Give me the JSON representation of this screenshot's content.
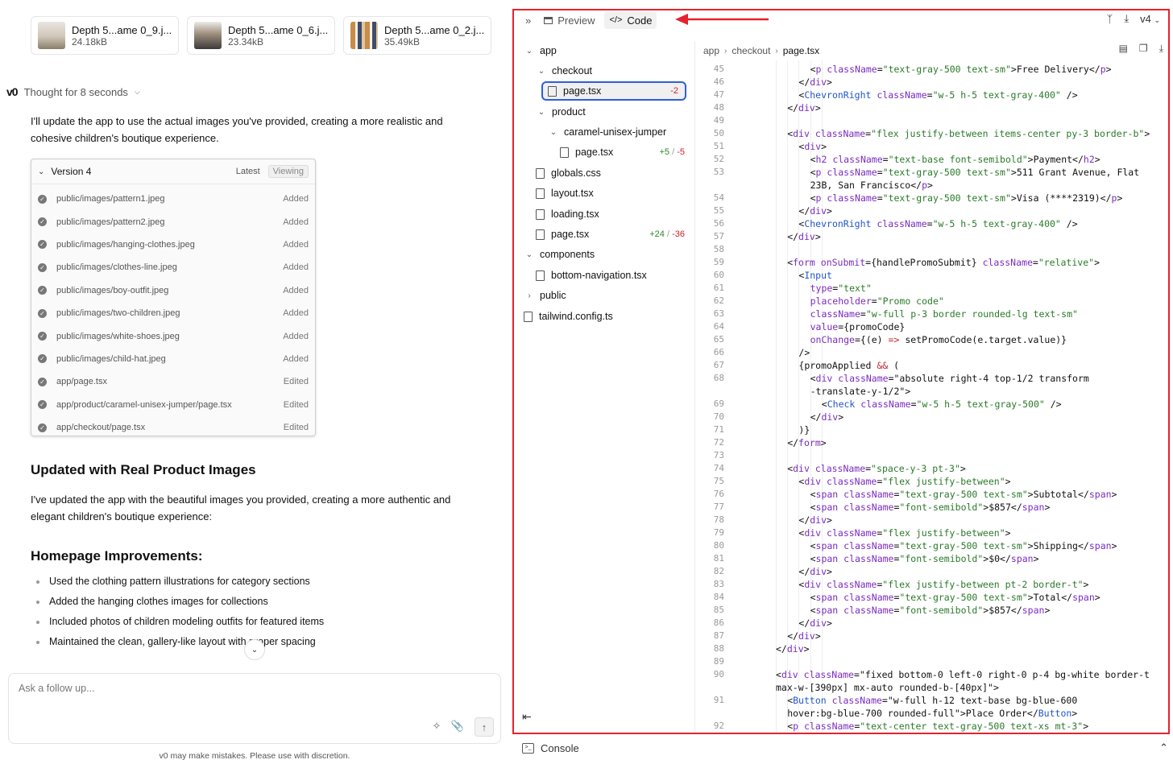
{
  "colors": {
    "accent_red": "#e5222f",
    "selection_blue": "#2f5fd8",
    "add_green": "#2a8a2a",
    "del_red": "#c8262d"
  },
  "attachments": [
    {
      "name": "Depth 5...ame 0_9.j...",
      "size": "24.18kB"
    },
    {
      "name": "Depth 5...ame 0_6.j...",
      "size": "23.34kB"
    },
    {
      "name": "Depth 5...ame 0_2.j...",
      "size": "35.49kB"
    }
  ],
  "chat": {
    "logo": "v0",
    "thought": "Thought for 8 seconds",
    "intro": "I'll update the app to use the actual images you've provided, creating a more realistic and cohesive children's boutique experience.",
    "version": {
      "title": "Version 4",
      "latest": "Latest",
      "viewing": "Viewing",
      "files": [
        {
          "path": "public/images/pattern1.jpeg",
          "status": "Added"
        },
        {
          "path": "public/images/pattern2.jpeg",
          "status": "Added"
        },
        {
          "path": "public/images/hanging-clothes.jpeg",
          "status": "Added"
        },
        {
          "path": "public/images/clothes-line.jpeg",
          "status": "Added"
        },
        {
          "path": "public/images/boy-outfit.jpeg",
          "status": "Added"
        },
        {
          "path": "public/images/two-children.jpeg",
          "status": "Added"
        },
        {
          "path": "public/images/white-shoes.jpeg",
          "status": "Added"
        },
        {
          "path": "public/images/child-hat.jpeg",
          "status": "Added"
        },
        {
          "path": "app/page.tsx",
          "status": "Edited"
        },
        {
          "path": "app/product/caramel-unisex-jumper/page.tsx",
          "status": "Edited"
        },
        {
          "path": "app/checkout/page.tsx",
          "status": "Edited"
        }
      ]
    },
    "heading1": "Updated with Real Product Images",
    "para2": "I've updated the app with the beautiful images you provided, creating a more authentic and elegant children's boutique experience:",
    "heading2": "Homepage Improvements:",
    "bullets": [
      "Used the clothing pattern illustrations for category sections",
      "Added the hanging clothes images for collections",
      "Included photos of children modeling outfits for featured items",
      "Maintained the clean, gallery-like layout with proper spacing"
    ],
    "input_placeholder": "Ask a follow up...",
    "disclaimer": "v0 may make mistakes. Please use with discretion."
  },
  "code_pane": {
    "tabs": {
      "preview": "Preview",
      "code": "Code"
    },
    "version_select": "v4",
    "tree": [
      {
        "label": "app",
        "type": "folder",
        "level": 0,
        "open": true
      },
      {
        "label": "checkout",
        "type": "folder",
        "level": 1,
        "open": true
      },
      {
        "label": "page.tsx",
        "type": "file",
        "level": 2,
        "diff_del": "-2",
        "selected": true
      },
      {
        "label": "product",
        "type": "folder",
        "level": 1,
        "open": true
      },
      {
        "label": "caramel-unisex-jumper",
        "type": "folder",
        "level": 2,
        "open": true
      },
      {
        "label": "page.tsx",
        "type": "file",
        "level": 3,
        "diff_add": "+5",
        "diff_del": "-5"
      },
      {
        "label": "globals.css",
        "type": "file",
        "level": 1
      },
      {
        "label": "layout.tsx",
        "type": "file",
        "level": 1
      },
      {
        "label": "loading.tsx",
        "type": "file",
        "level": 1
      },
      {
        "label": "page.tsx",
        "type": "file",
        "level": 1,
        "diff_add": "+24",
        "diff_del": "-36"
      },
      {
        "label": "components",
        "type": "folder",
        "level": 0,
        "open": true
      },
      {
        "label": "bottom-navigation.tsx",
        "type": "file",
        "level": 1
      },
      {
        "label": "public",
        "type": "folder",
        "level": 0,
        "open": false
      },
      {
        "label": "tailwind.config.ts",
        "type": "file",
        "level": 0
      }
    ],
    "breadcrumb": [
      "app",
      "checkout",
      "page.tsx"
    ],
    "code_lines": [
      {
        "n": "45",
        "i": 3,
        "t": "<p className=\"text-gray-500 text-sm\">Free Delivery</p>"
      },
      {
        "n": "46",
        "i": 2,
        "t": "</div>"
      },
      {
        "n": "47",
        "i": 2,
        "t": "<ChevronRight className=\"w-5 h-5 text-gray-400\" />"
      },
      {
        "n": "48",
        "i": 1,
        "t": "</div>"
      },
      {
        "n": "49",
        "i": 0,
        "t": ""
      },
      {
        "n": "50",
        "i": 1,
        "t": "<div className=\"flex justify-between items-center py-3 border-b\">"
      },
      {
        "n": "51",
        "i": 2,
        "t": "<div>"
      },
      {
        "n": "52",
        "i": 3,
        "t": "<h2 className=\"text-base font-semibold\">Payment</h2>"
      },
      {
        "n": "53",
        "i": 3,
        "t": "<p className=\"text-gray-500 text-sm\">511 Grant Avenue, Flat"
      },
      {
        "n": "",
        "i": 3,
        "t": "23B, San Francisco</p>"
      },
      {
        "n": "54",
        "i": 3,
        "t": "<p className=\"text-gray-500 text-sm\">Visa (****2319)</p>"
      },
      {
        "n": "55",
        "i": 2,
        "t": "</div>"
      },
      {
        "n": "56",
        "i": 2,
        "t": "<ChevronRight className=\"w-5 h-5 text-gray-400\" />"
      },
      {
        "n": "57",
        "i": 1,
        "t": "</div>"
      },
      {
        "n": "58",
        "i": 0,
        "t": ""
      },
      {
        "n": "59",
        "i": 1,
        "t": "<form onSubmit={handlePromoSubmit} className=\"relative\">"
      },
      {
        "n": "60",
        "i": 2,
        "t": "<Input"
      },
      {
        "n": "61",
        "i": 3,
        "t": "type=\"text\""
      },
      {
        "n": "62",
        "i": 3,
        "t": "placeholder=\"Promo code\""
      },
      {
        "n": "63",
        "i": 3,
        "t": "className=\"w-full p-3 border rounded-lg text-sm\""
      },
      {
        "n": "64",
        "i": 3,
        "t": "value={promoCode}"
      },
      {
        "n": "65",
        "i": 3,
        "t": "onChange={(e) => setPromoCode(e.target.value)}"
      },
      {
        "n": "66",
        "i": 2,
        "t": "/>"
      },
      {
        "n": "67",
        "i": 2,
        "t": "{promoApplied && ("
      },
      {
        "n": "68",
        "i": 3,
        "t": "<div className=\"absolute right-4 top-1/2 transform"
      },
      {
        "n": "",
        "i": 3,
        "t": "-translate-y-1/2\">"
      },
      {
        "n": "69",
        "i": 4,
        "t": "<Check className=\"w-5 h-5 text-gray-500\" />"
      },
      {
        "n": "70",
        "i": 3,
        "t": "</div>"
      },
      {
        "n": "71",
        "i": 2,
        "t": ")}"
      },
      {
        "n": "72",
        "i": 1,
        "t": "</form>"
      },
      {
        "n": "73",
        "i": 0,
        "t": ""
      },
      {
        "n": "74",
        "i": 1,
        "t": "<div className=\"space-y-3 pt-3\">"
      },
      {
        "n": "75",
        "i": 2,
        "t": "<div className=\"flex justify-between\">"
      },
      {
        "n": "76",
        "i": 3,
        "t": "<span className=\"text-gray-500 text-sm\">Subtotal</span>"
      },
      {
        "n": "77",
        "i": 3,
        "t": "<span className=\"font-semibold\">$857</span>"
      },
      {
        "n": "78",
        "i": 2,
        "t": "</div>"
      },
      {
        "n": "79",
        "i": 2,
        "t": "<div className=\"flex justify-between\">"
      },
      {
        "n": "80",
        "i": 3,
        "t": "<span className=\"text-gray-500 text-sm\">Shipping</span>"
      },
      {
        "n": "81",
        "i": 3,
        "t": "<span className=\"font-semibold\">$0</span>"
      },
      {
        "n": "82",
        "i": 2,
        "t": "</div>"
      },
      {
        "n": "83",
        "i": 2,
        "t": "<div className=\"flex justify-between pt-2 border-t\">"
      },
      {
        "n": "84",
        "i": 3,
        "t": "<span className=\"text-gray-500 text-sm\">Total</span>"
      },
      {
        "n": "85",
        "i": 3,
        "t": "<span className=\"font-semibold\">$857</span>"
      },
      {
        "n": "86",
        "i": 2,
        "t": "</div>"
      },
      {
        "n": "87",
        "i": 1,
        "t": "</div>"
      },
      {
        "n": "88",
        "i": 0,
        "t": "</div>"
      },
      {
        "n": "89",
        "i": 0,
        "t": ""
      },
      {
        "n": "90",
        "i": 0,
        "t": "<div className=\"fixed bottom-0 left-0 right-0 p-4 bg-white border-t"
      },
      {
        "n": "",
        "i": 0,
        "t": "max-w-[390px] mx-auto rounded-b-[40px]\">"
      },
      {
        "n": "91",
        "i": 1,
        "t": "<Button className=\"w-full h-12 text-base bg-blue-600"
      },
      {
        "n": "",
        "i": 1,
        "t": "hover:bg-blue-700 rounded-full\">Place Order</Button>"
      },
      {
        "n": "92",
        "i": 1,
        "t": "<p className=\"text-center text-gray-500 text-xs mt-3\">"
      }
    ],
    "console_label": "Console"
  }
}
